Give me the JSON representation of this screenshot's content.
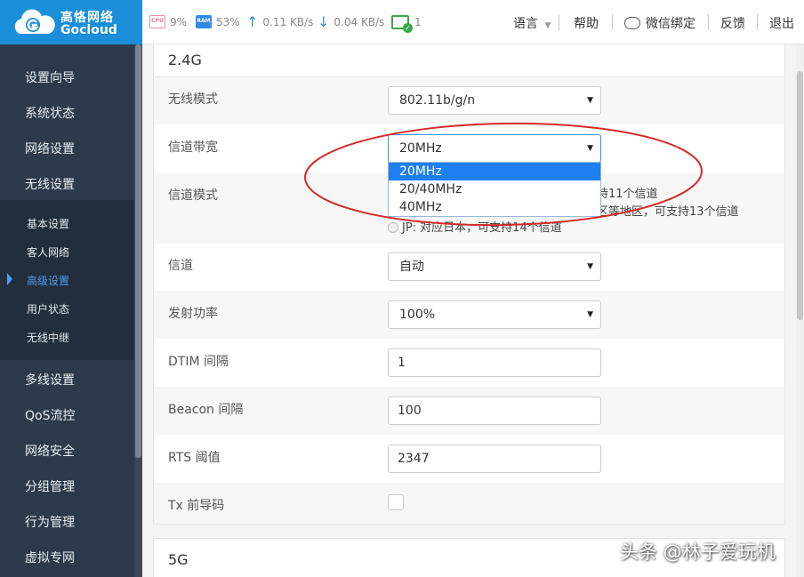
{
  "brand": {
    "name_cn": "高恪网络",
    "name_en": "Gocloud"
  },
  "status": {
    "cpu_label": "CPU",
    "cpu": "9%",
    "ram_label": "RAM",
    "ram": "53%",
    "upload": "0.11 KB/s",
    "download": "0.04 KB/s",
    "devices": "1"
  },
  "topmenu": {
    "language": "语言",
    "help": "帮助",
    "wechat": "微信绑定",
    "feedback": "反馈",
    "logout": "退出"
  },
  "sidebar": {
    "items": [
      "设置向导",
      "系统状态",
      "网络设置",
      "无线设置"
    ],
    "subitems": [
      "基本设置",
      "客人网络",
      "高级设置",
      "用户状态",
      "无线中继"
    ],
    "active_subitem": "高级设置",
    "items_after": [
      "多线设置",
      "QoS流控",
      "网络安全",
      "分组管理",
      "行为管理",
      "虚拟专网"
    ]
  },
  "section_24g": {
    "title": "2.4G",
    "wireless_mode": {
      "label": "无线模式",
      "value": "802.11b/g/n"
    },
    "bandwidth": {
      "label": "信道带宽",
      "value": "20MHz",
      "options": [
        "20MHz",
        "20/40MHz",
        "40MHz"
      ]
    },
    "channel_mode": {
      "label": "信道模式",
      "opt1_tail": "持11个信道",
      "opt2_tail": "区等地区，可支持13个信道",
      "opt3": "JP: 对应日本，可支持14个信道"
    },
    "channel": {
      "label": "信道",
      "value": "自动"
    },
    "tx_power": {
      "label": "发射功率",
      "value": "100%"
    },
    "dtim": {
      "label": "DTIM 间隔",
      "value": "1"
    },
    "beacon": {
      "label": "Beacon 间隔",
      "value": "100"
    },
    "rts": {
      "label": "RTS 阈值",
      "value": "2347"
    },
    "preamble": {
      "label": "Tx 前导码"
    }
  },
  "section_5g": {
    "title": "5G"
  },
  "watermark": "头条 @林子爱玩机",
  "colors": {
    "brand": "#1a8ed9",
    "sidebar": "#2d3a4b",
    "highlight": "#1e80f0",
    "annotation": "#d32a2a"
  }
}
